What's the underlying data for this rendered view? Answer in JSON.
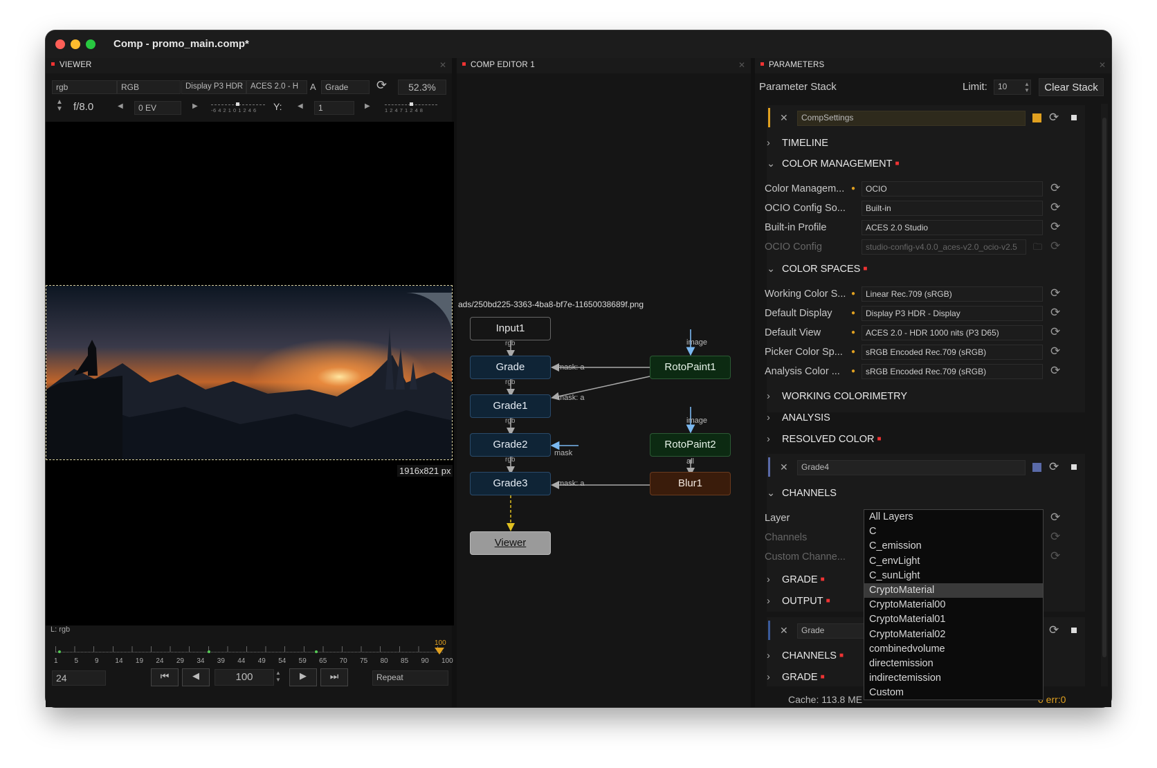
{
  "window": {
    "title": "Comp - promo_main.comp*"
  },
  "viewer": {
    "title": "VIEWER",
    "channel_field": "rgb",
    "mode_field": "RGB",
    "display_field": "Display P3 HDR",
    "view_field": "ACES 2.0 - H",
    "a_label": "A",
    "grade_field": "Grade",
    "zoom": "52.3%",
    "fstop": "f/8.0",
    "ev_field": "0 EV",
    "y_label": "Y:",
    "y_field": "1",
    "ev_scale": "-6 4 2 1   0   1 2 4 6",
    "y_scale": "1 2 4 7 1 2 4 8",
    "resolution": "1916x821 px",
    "layer_label": "L: rgb",
    "timeline_ticks": [
      "1",
      "5",
      "9",
      "14",
      "19",
      "24",
      "29",
      "34",
      "39",
      "44",
      "49",
      "54",
      "59",
      "65",
      "70",
      "75",
      "80",
      "85",
      "90",
      "100"
    ],
    "timeline_end": "100",
    "current_frame": "24",
    "end_frame": "100",
    "repeat_label": "Repeat"
  },
  "comp_editor": {
    "title": "COMP EDITOR 1",
    "file_path": "ads/250bd225-3363-4ba8-bf7e-11650038689f.png",
    "nodes": {
      "input1": "Input1",
      "grade": "Grade",
      "grade1": "Grade1",
      "grade2": "Grade2",
      "grade3": "Grade3",
      "viewer": "Viewer",
      "rotopaint1": "RotoPaint1",
      "rotopaint2": "RotoPaint2",
      "blur1": "Blur1"
    },
    "edge_labels": {
      "rgb": "rgb",
      "mask_a": "mask: a",
      "mask": "mask",
      "image": "image",
      "all": "all"
    }
  },
  "parameters": {
    "title": "PARAMETERS",
    "stack_label": "Parameter Stack",
    "limit_label": "Limit:",
    "limit_value": "10",
    "clear_stack": "Clear Stack",
    "comp_settings": "CompSettings",
    "sections": {
      "timeline": "TIMELINE",
      "color_management": "COLOR MANAGEMENT",
      "color_spaces": "COLOR SPACES",
      "working_colorimetry": "WORKING COLORIMETRY",
      "analysis": "ANALYSIS",
      "resolved_color": "RESOLVED COLOR",
      "channels": "CHANNELS",
      "grade": "GRADE",
      "output": "OUTPUT",
      "channels2": "CHANNELS",
      "grade2": "GRADE"
    },
    "color_management": {
      "cm_label": "Color Managem...",
      "cm_value": "OCIO",
      "ocio_src_label": "OCIO Config So...",
      "ocio_src_value": "Built-in",
      "profile_label": "Built-in Profile",
      "profile_value": "ACES 2.0 Studio",
      "ocio_label": "OCIO Config",
      "ocio_value": "studio-config-v4.0.0_aces-v2.0_ocio-v2.5"
    },
    "color_spaces": {
      "working_label": "Working Color S...",
      "working_value": "Linear Rec.709 (sRGB)",
      "display_label": "Default Display",
      "display_value": "Display P3 HDR - Display",
      "view_label": "Default View",
      "view_value": "ACES 2.0 - HDR 1000 nits (P3 D65)",
      "picker_label": "Picker Color Sp...",
      "picker_value": "sRGB Encoded Rec.709 (sRGB)",
      "analysis_label": "Analysis Color ...",
      "analysis_value": "sRGB Encoded Rec.709 (sRGB)"
    },
    "grade4": "Grade4",
    "channels": {
      "layer_label": "Layer",
      "channels_label": "Channels",
      "custom_label": "Custom Channe..."
    },
    "grade_node": "Grade",
    "layer_options": [
      "All Layers",
      "C",
      "C_emission",
      "C_envLight",
      "C_sunLight",
      "CryptoMaterial",
      "CryptoMaterial00",
      "CryptoMaterial01",
      "CryptoMaterial02",
      "combinedvolume",
      "directemission",
      "indirectemission",
      "Custom"
    ],
    "layer_selected": "CryptoMaterial",
    "status_cache": "Cache: 113.8 ME",
    "status_queue": "0 err:0"
  }
}
